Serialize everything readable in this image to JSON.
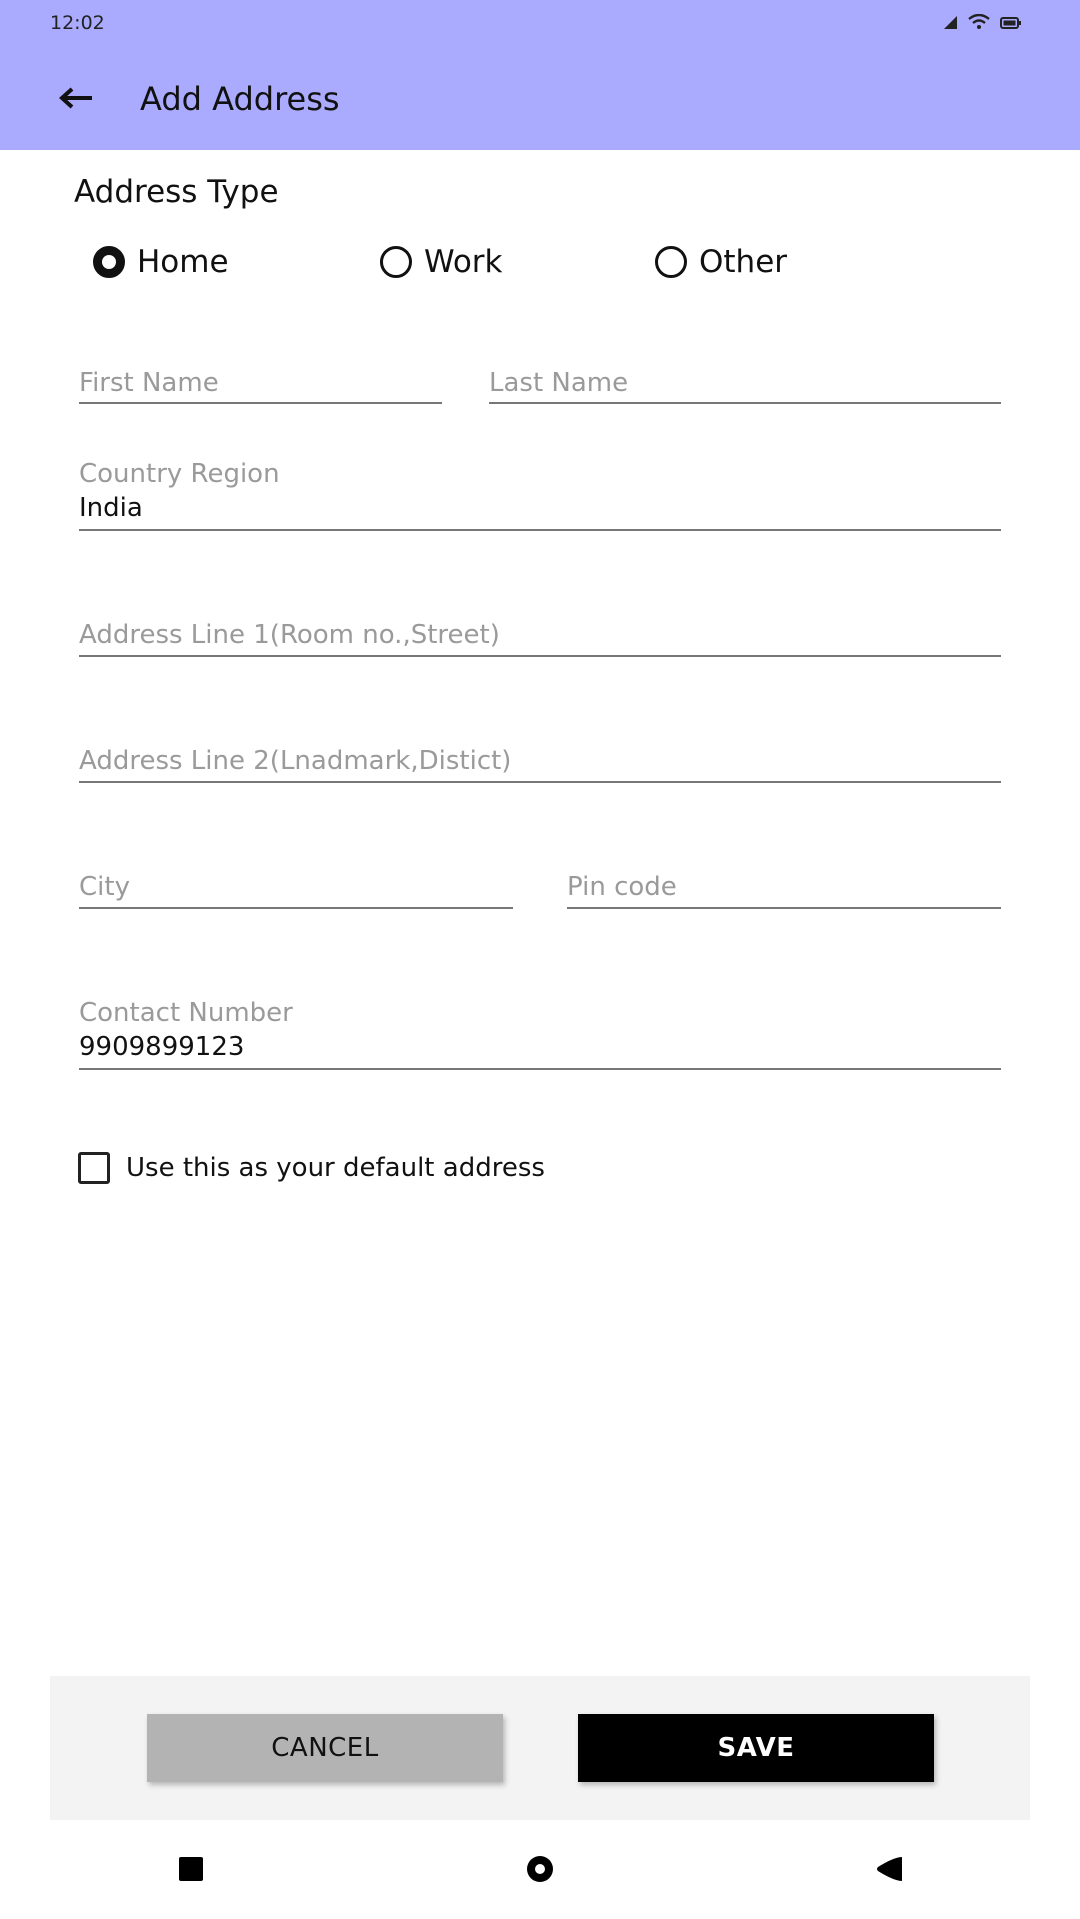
{
  "status_bar": {
    "time": "12:02",
    "icons": [
      "signal-icon",
      "wifi-icon",
      "battery-icon"
    ]
  },
  "app_bar": {
    "title": "Add Address",
    "back_icon": "back-arrow-icon",
    "background": "#aaaafe"
  },
  "address_type": {
    "title": "Address Type",
    "options": [
      {
        "label": "Home",
        "selected": true
      },
      {
        "label": "Work",
        "selected": false
      },
      {
        "label": "Other",
        "selected": false
      }
    ]
  },
  "form": {
    "first_name": {
      "placeholder": "First Name",
      "value": ""
    },
    "last_name": {
      "placeholder": "Last Name",
      "value": ""
    },
    "country_region": {
      "label": "Country Region",
      "value": "India"
    },
    "address_line1": {
      "placeholder": "Address Line 1(Room no.,Street)",
      "value": ""
    },
    "address_line2": {
      "placeholder": "Address Line 2(Lnadmark,Distict)",
      "value": ""
    },
    "city": {
      "placeholder": "City",
      "value": ""
    },
    "pin_code": {
      "placeholder": "Pin code",
      "value": ""
    },
    "contact_number": {
      "label": "Contact Number",
      "value": "9909899123"
    }
  },
  "default_address": {
    "label": "Use this as your default address",
    "checked": false
  },
  "actions": {
    "cancel_label": "CANCEL",
    "save_label": "SAVE"
  },
  "nav_bar": {
    "items": [
      "recents-square-icon",
      "home-circle-icon",
      "back-triangle-icon"
    ]
  }
}
